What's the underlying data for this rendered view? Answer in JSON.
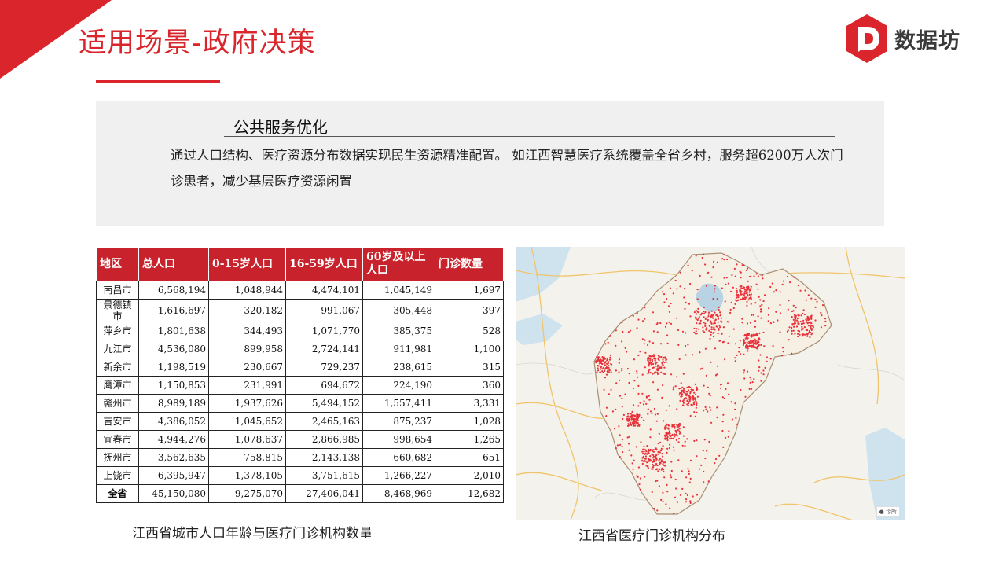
{
  "header": {
    "title": "适用场景-政府决策",
    "brand": "数据坊",
    "accent_color": "#d9252b"
  },
  "panel": {
    "heading": "公共服务优化",
    "body": "通过人口结构、医疗资源分布数据实现民生资源精准配置。 如江西智慧医疗系统覆盖全省乡村，服务超6200万人次门诊患者，减少基层医疗资源闲置"
  },
  "table": {
    "columns": [
      "地区",
      "总人口",
      "0-15岁人口",
      "16-59岁人口",
      "60岁及以上人口",
      "门诊数量"
    ],
    "rows": [
      [
        "南昌市",
        "6,568,194",
        "1,048,944",
        "4,474,101",
        "1,045,149",
        "1,697"
      ],
      [
        "景德镇市",
        "1,616,697",
        "320,182",
        "991,067",
        "305,448",
        "397"
      ],
      [
        "萍乡市",
        "1,801,638",
        "344,493",
        "1,071,770",
        "385,375",
        "528"
      ],
      [
        "九江市",
        "4,536,080",
        "899,958",
        "2,724,141",
        "911,981",
        "1,100"
      ],
      [
        "新余市",
        "1,198,519",
        "230,667",
        "729,237",
        "238,615",
        "315"
      ],
      [
        "鹰潭市",
        "1,150,853",
        "231,991",
        "694,672",
        "224,190",
        "360"
      ],
      [
        "赣州市",
        "8,989,189",
        "1,937,626",
        "5,494,152",
        "1,557,411",
        "3,331"
      ],
      [
        "吉安市",
        "4,386,052",
        "1,045,652",
        "2,465,163",
        "875,237",
        "1,028"
      ],
      [
        "宜春市",
        "4,944,276",
        "1,078,637",
        "2,866,985",
        "998,654",
        "1,265"
      ],
      [
        "抚州市",
        "3,562,635",
        "758,815",
        "2,143,138",
        "660,682",
        "651"
      ],
      [
        "上饶市",
        "6,395,947",
        "1,378,105",
        "3,751,615",
        "1,266,227",
        "2,010"
      ]
    ],
    "total": [
      "全省",
      "45,150,080",
      "9,275,070",
      "27,406,041",
      "8,468,969",
      "12,682"
    ],
    "caption": "江西省城市人口年龄与医疗门诊机构数量"
  },
  "map": {
    "caption": "江西省医疗门诊机构分布",
    "legend_label": "诊所",
    "dot_color": "#e8313a"
  }
}
